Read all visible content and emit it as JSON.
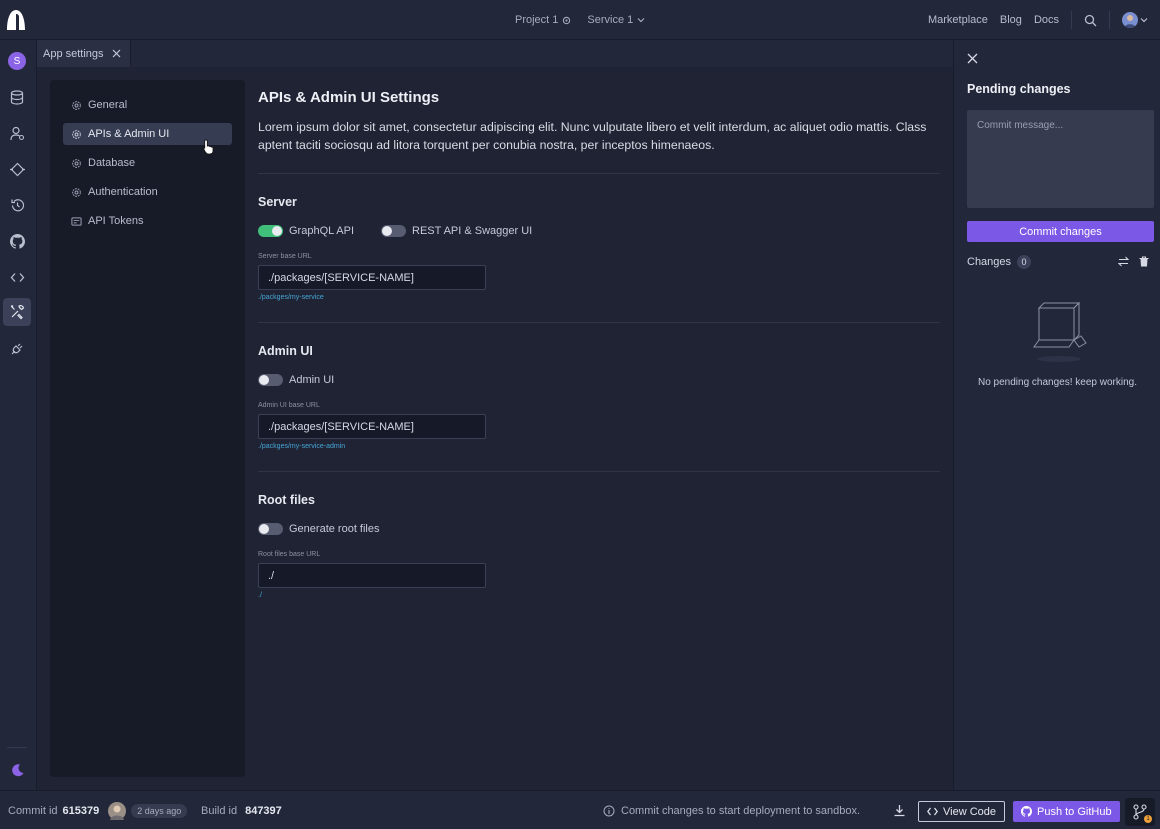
{
  "topbar": {
    "project": "Project 1",
    "service": "Service 1",
    "links": [
      "Marketplace",
      "Blog",
      "Docs"
    ]
  },
  "rail": {
    "avatar_letter": "S"
  },
  "tab": {
    "label": "App settings"
  },
  "subnav": {
    "items": [
      {
        "label": "General",
        "icon": "gear-icon"
      },
      {
        "label": "APIs & Admin UI",
        "icon": "gear-icon",
        "active": true
      },
      {
        "label": "Database",
        "icon": "gear-icon"
      },
      {
        "label": "Authentication",
        "icon": "gear-icon"
      },
      {
        "label": "API Tokens",
        "icon": "token-icon"
      }
    ]
  },
  "content": {
    "title": "APIs & Admin UI Settings",
    "description": "Lorem ipsum dolor sit amet, consectetur adipiscing elit. Nunc vulputate libero et velit interdum, ac aliquet odio mattis. Class aptent taciti sociosqu ad litora torquent per conubia nostra, per inceptos himenaeos.",
    "server": {
      "title": "Server",
      "graphql_label": "GraphQL API",
      "graphql_on": true,
      "rest_label": "REST API & Swagger UI",
      "rest_on": false,
      "field_label": "Server base URL",
      "field_value": "./packages/[SERVICE-NAME]",
      "hint": "./packges/my-service"
    },
    "admin": {
      "title": "Admin UI",
      "toggle_label": "Admin UI",
      "toggle_on": false,
      "field_label": "Admin UI base URL",
      "field_value": "./packages/[SERVICE-NAME]",
      "hint": "./packges/my-service-admin"
    },
    "root": {
      "title": "Root files",
      "toggle_label": "Generate root files",
      "toggle_on": false,
      "field_label": "Root files base URL",
      "field_value": "./",
      "hint": "./"
    }
  },
  "panel": {
    "title": "Pending changes",
    "message_placeholder": "Commit message...",
    "commit_label": "Commit changes",
    "changes_label": "Changes",
    "changes_count": "0",
    "empty_text": "No pending changes! keep working."
  },
  "footer": {
    "commit_label": "Commit id",
    "commit_id": "615379",
    "time": "2 days ago",
    "build_label": "Build id",
    "build_id": "847397",
    "info": "Commit changes to start deployment to sandbox.",
    "view_code": "View Code",
    "push": "Push to GitHub",
    "git_badge": "1"
  },
  "colors": {
    "accent": "#7c58e6",
    "toggle_on": "#3fbf79",
    "hint": "#45a6d6",
    "warning": "#f0a23a"
  }
}
